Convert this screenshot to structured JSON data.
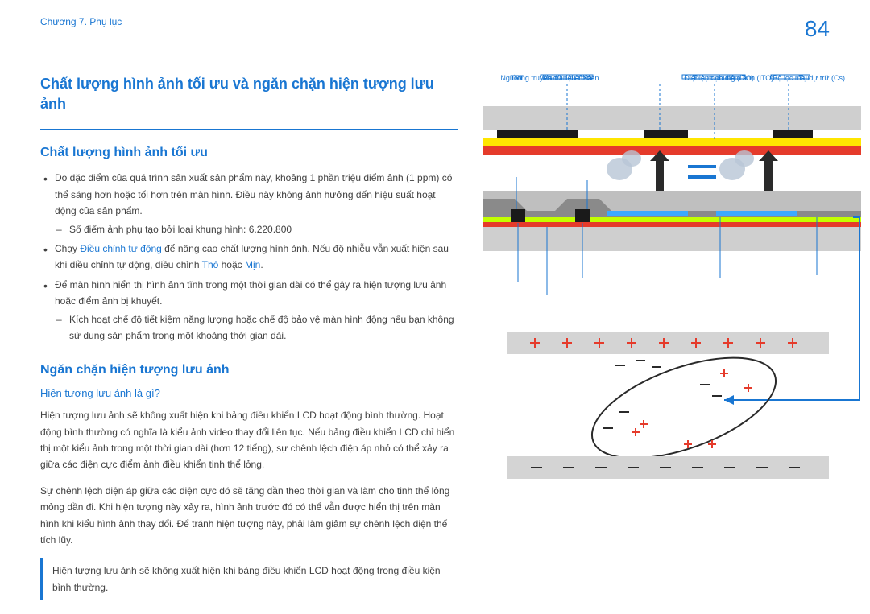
{
  "header": {
    "chapter": "Chương 7. Phụ lục",
    "page_number": "84"
  },
  "main_title": "Chất lượng hình ảnh tối ưu và ngăn chặn hiện tượng lưu ảnh",
  "section1": {
    "title": "Chất lượng hình ảnh tối ưu",
    "b1_pre": "Do đặc điểm của quá trình sản xuất sản phẩm này, khoảng 1 phần triệu điểm ảnh (1 ppm) có thể sáng hơn hoặc tối hơn trên màn hình. Điều này không ảnh hưởng đến hiệu suất hoạt động của sản phẩm.",
    "b1_dash": "Số điểm ảnh phụ tạo bởi loại khung hình: 6.220.800",
    "b2_a": "Chạy ",
    "b2_link1": "Điều chỉnh tự động",
    "b2_b": " để nâng cao chất lượng hình ảnh. Nếu độ nhiễu vẫn xuất hiện sau khi điều chỉnh tự động, điều chỉnh ",
    "b2_link2": "Thô",
    "b2_c": " hoặc ",
    "b2_link3": "Mịn",
    "b2_d": ".",
    "b3": "Để màn hình hiển thị hình ảnh tĩnh trong một thời gian dài có thể gây ra hiện tượng lưu ảnh hoặc điểm ảnh bị khuyết.",
    "b3_dash": "Kích hoạt chế độ tiết kiệm năng lượng hoặc chế độ bảo vệ màn hình động nếu bạn không sử dụng sản phẩm trong một khoảng thời gian dài."
  },
  "section2": {
    "title": "Ngăn chặn hiện tượng lưu ảnh",
    "subtitle": "Hiện tượng lưu ảnh là gì?",
    "p1": "Hiện tượng lưu ảnh sẽ không xuất hiện khi bảng điều khiển LCD hoạt động bình thường. Hoạt động bình thường có nghĩa là kiểu ảnh video thay đổi liên tục. Nếu bảng điều khiển LCD chỉ hiển thị một kiểu ảnh trong một thời gian dài (hơn 12 tiếng), sự chênh lệch điện áp nhỏ có thể xảy ra giữa các điện cực điểm ảnh điều khiển tinh thể lỏng.",
    "p2": "Sự chênh lệch điện áp giữa các điện cực đó sẽ tăng dần theo thời gian và làm cho tinh thể lỏng mỏng dần đi. Khi hiện tượng này xảy ra, hình ảnh trước đó có thể vẫn được hiển thị trên màn hình khi kiểu hình ảnh thay đổi. Để tránh hiện tượng này, phải làm giảm sự chênh lệch điện thế tích lũy.",
    "note": "Hiện tượng lưu ảnh sẽ không xuất hiện khi bảng điều khiển LCD hoạt động trong điều kiện bình thường."
  },
  "diagram_labels": {
    "black_matrix": "Ma trận điểm đen",
    "common_electrode": "Điện cực chung (ITO)",
    "color_filter": "Bộ lọc màu",
    "source": "Nguồn",
    "drain": "Xả",
    "tft": "TFT",
    "gate": "Cửa",
    "data_line": "Dòng truyền dữ liệu",
    "pixel_electrode": "Điện cực điểm ảnh (ITO)",
    "storage_cap": "Tụ dự trữ (Cs)"
  }
}
